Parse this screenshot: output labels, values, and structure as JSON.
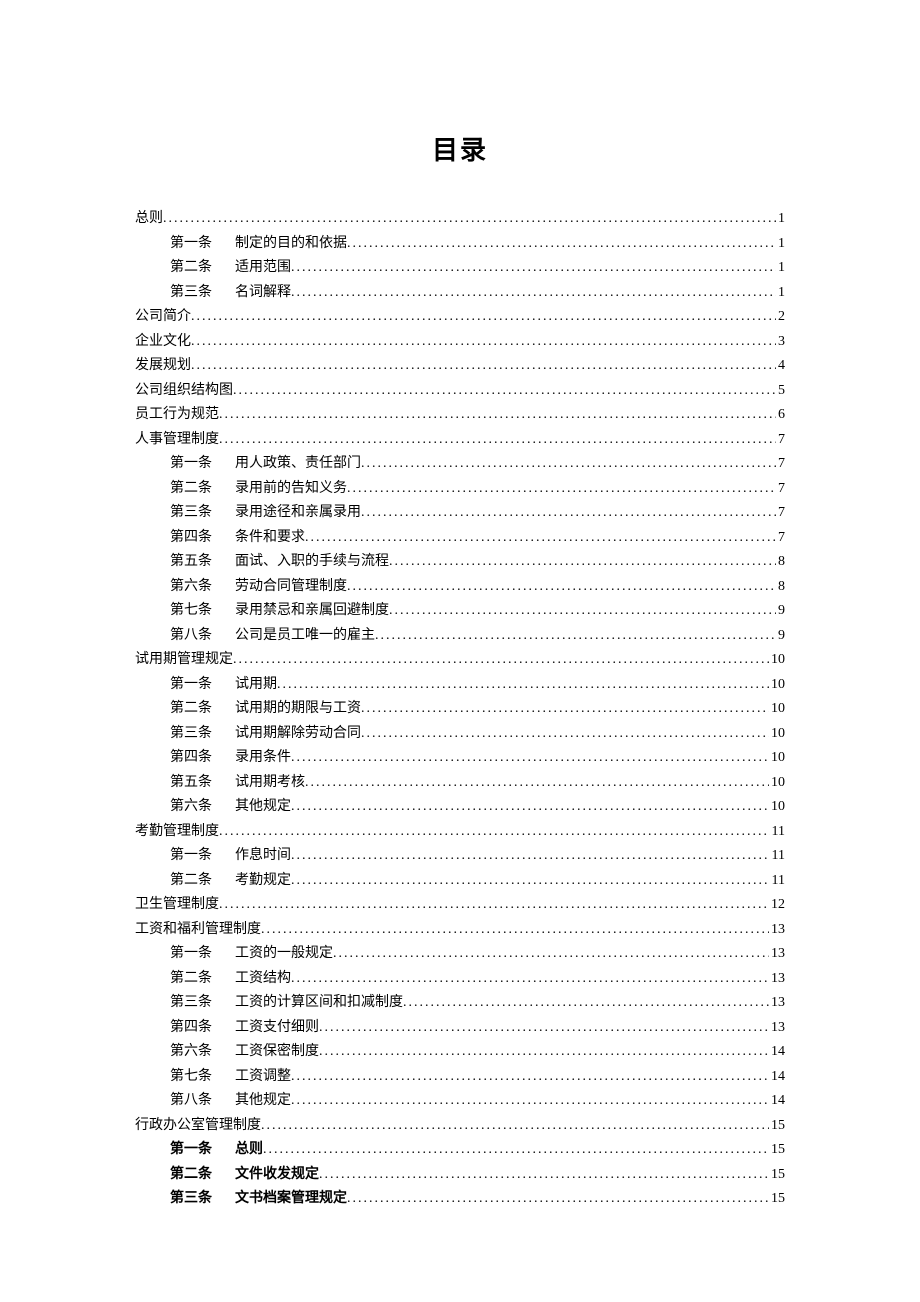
{
  "title": "目录",
  "toc": [
    {
      "level": 1,
      "label": "",
      "text": "总则",
      "page": "1",
      "bold": false
    },
    {
      "level": 2,
      "label": "第一条",
      "text": "制定的目的和依据",
      "page": "1",
      "bold": false
    },
    {
      "level": 2,
      "label": "第二条",
      "text": "适用范围",
      "page": "1",
      "bold": false
    },
    {
      "level": 2,
      "label": "第三条",
      "text": "名词解释",
      "page": "1",
      "bold": false
    },
    {
      "level": 1,
      "label": "",
      "text": "公司简介",
      "page": "2",
      "bold": false
    },
    {
      "level": 1,
      "label": "",
      "text": "企业文化",
      "page": "3",
      "bold": false
    },
    {
      "level": 1,
      "label": "",
      "text": "发展规划",
      "page": "4",
      "bold": false
    },
    {
      "level": 1,
      "label": "",
      "text": "公司组织结构图",
      "page": "5",
      "bold": false
    },
    {
      "level": 1,
      "label": "",
      "text": "员工行为规范",
      "page": "6",
      "bold": false
    },
    {
      "level": 1,
      "label": "",
      "text": "人事管理制度",
      "page": "7",
      "bold": false
    },
    {
      "level": 2,
      "label": "第一条",
      "text": "用人政策、责任部门",
      "page": "7",
      "bold": false
    },
    {
      "level": 2,
      "label": "第二条",
      "text": "录用前的告知义务",
      "page": "7",
      "bold": false
    },
    {
      "level": 2,
      "label": "第三条",
      "text": "录用途径和亲属录用",
      "page": "7",
      "bold": false
    },
    {
      "level": 2,
      "label": "第四条",
      "text": "条件和要求",
      "page": "7",
      "bold": false
    },
    {
      "level": 2,
      "label": "第五条",
      "text": "面试、入职的手续与流程",
      "page": "8",
      "bold": false
    },
    {
      "level": 2,
      "label": "第六条",
      "text": "劳动合同管理制度",
      "page": "8",
      "bold": false
    },
    {
      "level": 2,
      "label": "第七条",
      "text": "录用禁忌和亲属回避制度",
      "page": "9",
      "bold": false
    },
    {
      "level": 2,
      "label": "第八条",
      "text": "公司是员工唯一的雇主",
      "page": "9",
      "bold": false
    },
    {
      "level": 1,
      "label": "",
      "text": "试用期管理规定",
      "page": "10",
      "bold": false
    },
    {
      "level": 2,
      "label": "第一条",
      "text": "试用期",
      "page": "10",
      "bold": false
    },
    {
      "level": 2,
      "label": "第二条",
      "text": "试用期的期限与工资",
      "page": "10",
      "bold": false
    },
    {
      "level": 2,
      "label": "第三条",
      "text": "试用期解除劳动合同",
      "page": "10",
      "bold": false
    },
    {
      "level": 2,
      "label": "第四条",
      "text": "录用条件",
      "page": "10",
      "bold": false
    },
    {
      "level": 2,
      "label": "第五条",
      "text": "试用期考核",
      "page": "10",
      "bold": false
    },
    {
      "level": 2,
      "label": "第六条",
      "text": "其他规定",
      "page": "10",
      "bold": false
    },
    {
      "level": 1,
      "label": "",
      "text": "考勤管理制度",
      "page": "11",
      "bold": false
    },
    {
      "level": 2,
      "label": "第一条",
      "text": "作息时间",
      "page": "11",
      "bold": false
    },
    {
      "level": 2,
      "label": "第二条",
      "text": "考勤规定",
      "page": "11",
      "bold": false
    },
    {
      "level": 1,
      "label": "",
      "text": "卫生管理制度",
      "page": "12",
      "bold": false
    },
    {
      "level": 1,
      "label": "",
      "text": "工资和福利管理制度",
      "page": "13",
      "bold": false
    },
    {
      "level": 2,
      "label": "第一条",
      "text": "工资的一般规定",
      "page": "13",
      "bold": false
    },
    {
      "level": 2,
      "label": "第二条",
      "text": "工资结构",
      "page": "13",
      "bold": false
    },
    {
      "level": 2,
      "label": "第三条",
      "text": "工资的计算区间和扣减制度",
      "page": "13",
      "bold": false
    },
    {
      "level": 2,
      "label": "第四条",
      "text": "工资支付细则",
      "page": "13",
      "bold": false
    },
    {
      "level": 2,
      "label": "第六条",
      "text": "工资保密制度",
      "page": "14",
      "bold": false
    },
    {
      "level": 2,
      "label": "第七条",
      "text": "工资调整",
      "page": "14",
      "bold": false
    },
    {
      "level": 2,
      "label": "第八条",
      "text": "其他规定",
      "page": "14",
      "bold": false
    },
    {
      "level": 1,
      "label": "",
      "text": "行政办公室管理制度",
      "page": "15",
      "bold": false
    },
    {
      "level": 2,
      "label": "第一条",
      "text": "总则",
      "page": "15",
      "bold": true
    },
    {
      "level": 2,
      "label": "第二条",
      "text": "文件收发规定",
      "page": "15",
      "bold": true
    },
    {
      "level": 2,
      "label": "第三条",
      "text": "文书档案管理规定",
      "page": "15",
      "bold": true
    }
  ]
}
